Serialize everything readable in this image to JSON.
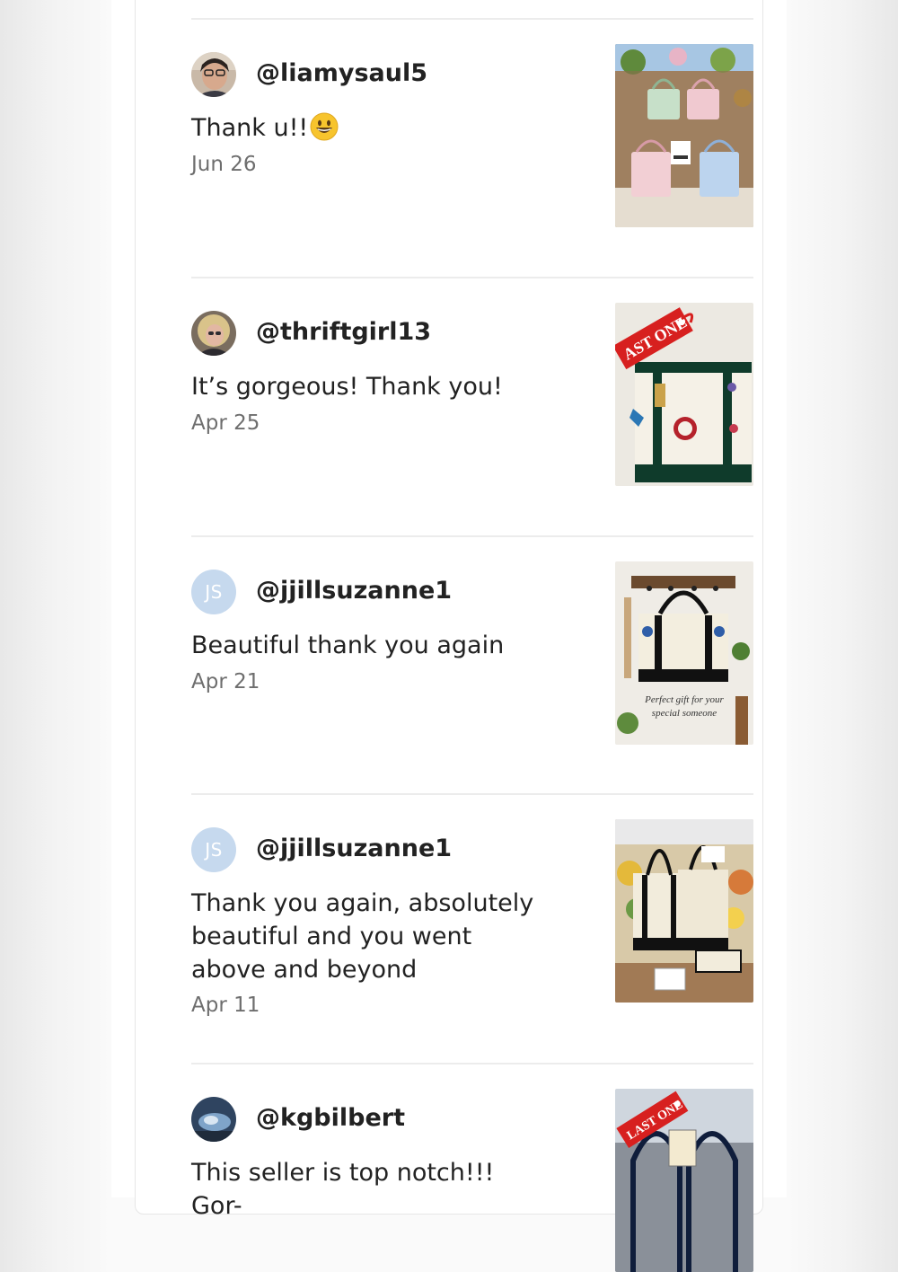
{
  "reviews": [
    {
      "username": "@liamysaul5",
      "avatar_type": "photo",
      "text": "Thank u!!",
      "emoji": "grinning-face-emoji",
      "date": "Jun 26",
      "thumbnail": "pastel-tote-bags-display-photo"
    },
    {
      "username": "@thriftgirl13",
      "avatar_type": "photo",
      "text": "It’s gorgeous! Thank you!",
      "date": "Apr 25",
      "thumbnail": "embroidered-tote-last-one-photo",
      "thumbnail_tag": "AST ONE"
    },
    {
      "username": "@jjillsuzanne1",
      "avatar_type": "initials",
      "initials": "JS",
      "text": "Beautiful thank you again",
      "date": "Apr 21",
      "thumbnail": "tote-on-hooks-gift-photo",
      "thumbnail_caption_line1": "Perfect gift for your",
      "thumbnail_caption_line2": "special someone"
    },
    {
      "username": "@jjillsuzanne1",
      "avatar_type": "initials",
      "initials": "JS",
      "text": "Thank you again, absolutely beautiful and you went above and beyond",
      "date": "Apr 11",
      "thumbnail": "tote-bags-market-photo"
    },
    {
      "username": "@kgbilbert",
      "avatar_type": "photo",
      "text": "This seller is top notch!!! Gor-",
      "thumbnail": "navy-tote-last-one-photo",
      "thumbnail_tag": "LAST ONE"
    }
  ],
  "colors": {
    "text": "#222222",
    "date": "#6e6e6e",
    "divider": "#ececec",
    "initials_avatar": "#c6d9ee",
    "tag_red": "#d7201f"
  }
}
